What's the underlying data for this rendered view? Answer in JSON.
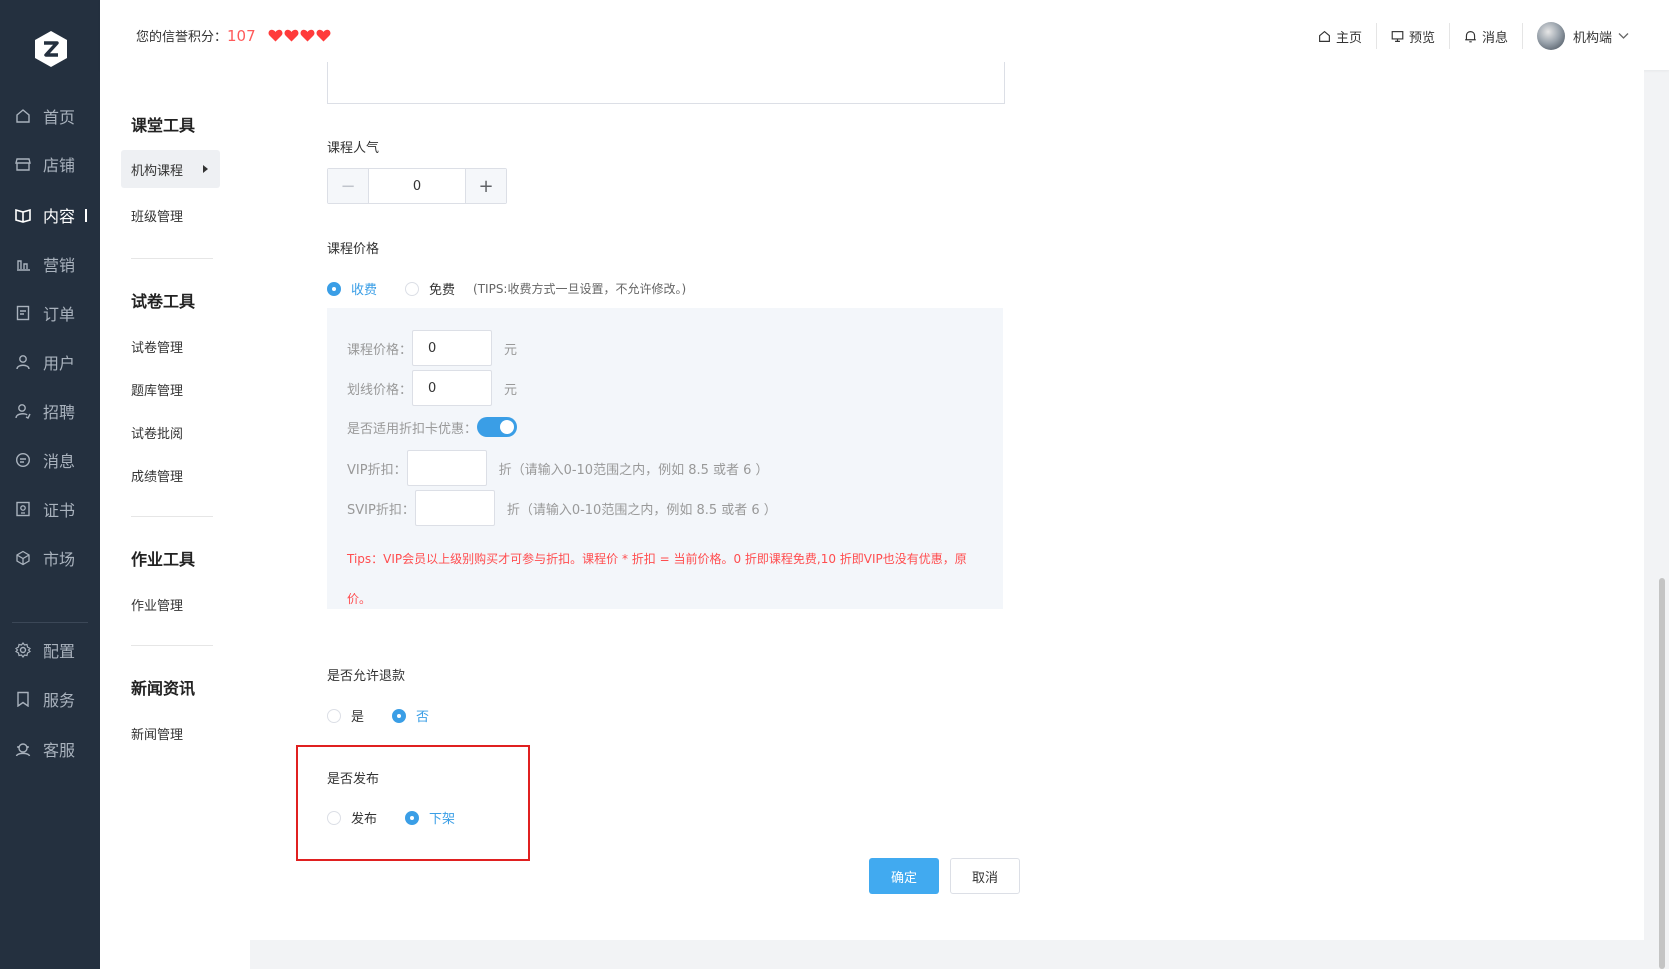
{
  "header": {
    "credit_label": "您的信誉积分：",
    "credit_score": "107",
    "hearts": 4,
    "links": [
      {
        "label": "主页",
        "icon": "home-icon"
      },
      {
        "label": "预览",
        "icon": "monitor-icon"
      },
      {
        "label": "消息",
        "icon": "bell-icon"
      }
    ],
    "user_name": "机构端"
  },
  "sidebar": {
    "items": [
      {
        "label": "首页",
        "icon": "home-icon"
      },
      {
        "label": "店铺",
        "icon": "store-icon"
      },
      {
        "label": "内容",
        "icon": "book-icon",
        "active": true
      },
      {
        "label": "营销",
        "icon": "chart-icon"
      },
      {
        "label": "订单",
        "icon": "order-icon"
      },
      {
        "label": "用户",
        "icon": "user-icon"
      },
      {
        "label": "招聘",
        "icon": "recruit-icon"
      },
      {
        "label": "消息",
        "icon": "chat-icon"
      },
      {
        "label": "证书",
        "icon": "certificate-icon"
      },
      {
        "label": "市场",
        "icon": "market-icon"
      },
      {
        "label": "配置",
        "icon": "gear-icon"
      },
      {
        "label": "服务",
        "icon": "bookmark-icon"
      },
      {
        "label": "客服",
        "icon": "support-icon"
      }
    ]
  },
  "submenu": {
    "groups": [
      {
        "title": "课堂工具",
        "items": [
          "机构课程",
          "班级管理"
        ]
      },
      {
        "title": "试卷工具",
        "items": [
          "试卷管理",
          "题库管理",
          "试卷批阅",
          "成绩管理"
        ]
      },
      {
        "title": "作业工具",
        "items": [
          "作业管理"
        ]
      },
      {
        "title": "新闻资讯",
        "items": [
          "新闻管理"
        ]
      }
    ]
  },
  "form": {
    "popularity": {
      "label": "课程人气",
      "value": "0",
      "minus": "−",
      "plus": "+"
    },
    "price": {
      "label": "课程价格",
      "options": [
        "收费",
        "免费"
      ],
      "selected": "收费",
      "tip": "(TIPS:收费方式一旦设置，不允许修改。)",
      "course_price_label": "课程价格：",
      "course_price_value": "0",
      "strike_price_label": "划线价格：",
      "strike_price_value": "0",
      "unit": "元",
      "discount_card_label": "是否适用折扣卡优惠：",
      "discount_card_enabled": true,
      "vip_label": "VIP折扣：",
      "vip_hint": "折（请输入0-10范围之内，例如 8.5 或者 6 ）",
      "svip_label": "SVIP折扣：",
      "svip_hint": "折（请输入0-10范围之内，例如 8.5 或者 6 ）",
      "red_tip": "Tips：VIP会员以上级别购买才可参与折扣。课程价 * 折扣 = 当前价格。0 折即课程免费,10 折即VIP也没有优惠，原价。"
    },
    "refund": {
      "label": "是否允许退款",
      "options": [
        "是",
        "否"
      ],
      "selected": "否"
    },
    "publish": {
      "label": "是否发布",
      "options": [
        "发布",
        "下架"
      ],
      "selected": "下架"
    },
    "buttons": {
      "confirm": "确定",
      "cancel": "取消"
    }
  },
  "colors": {
    "sidebar_bg": "#24303f",
    "accent": "#3a9ee6",
    "primary_button": "#41aaf0",
    "warning_text": "#ff4d4f",
    "highlight_border": "#e02020"
  }
}
